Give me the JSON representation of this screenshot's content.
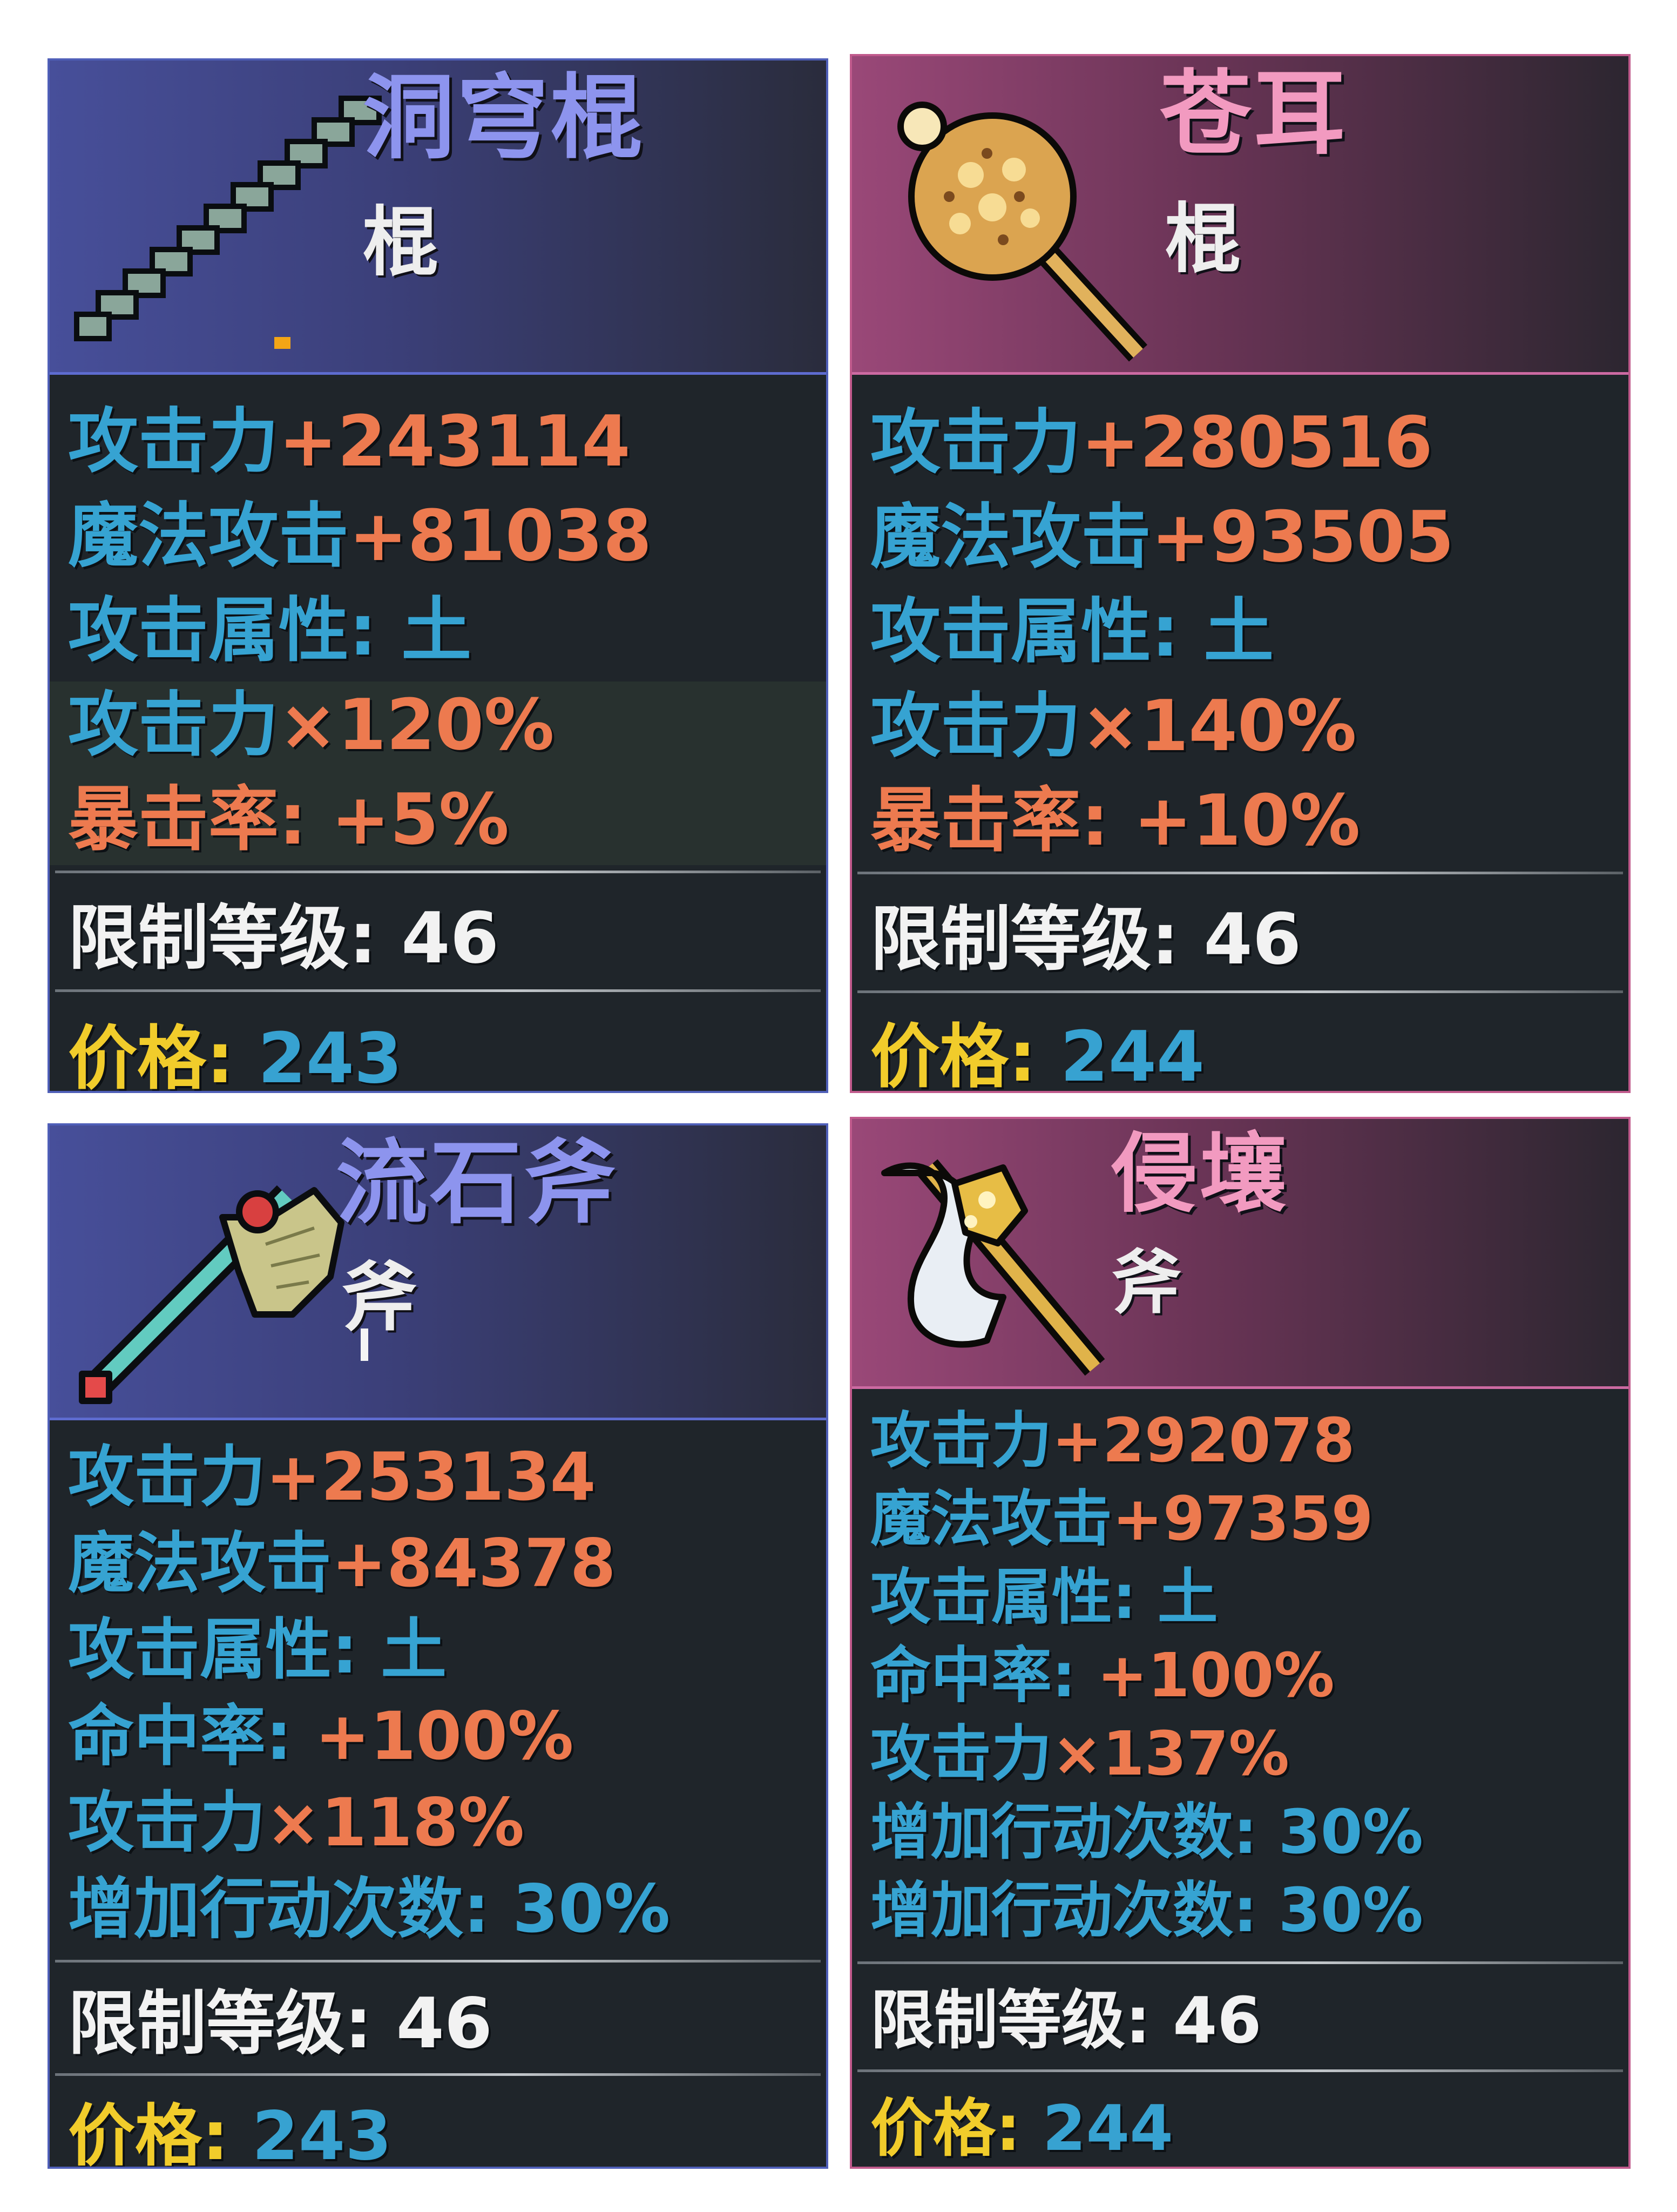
{
  "cards": [
    {
      "name": "洞穹棍",
      "type": "棍",
      "theme": "blue",
      "icon": "staff-icon",
      "stats": [
        {
          "label": "攻击力",
          "value": "+243114"
        },
        {
          "label": "魔法攻击",
          "value": "+81038"
        },
        {
          "label": "攻击属性: ",
          "value": "土"
        },
        {
          "label": "攻击力",
          "value": "×120%"
        },
        {
          "label": "暴击率: +5%",
          "value": ""
        }
      ],
      "requirement": "限制等级: 46",
      "price_label": "价格: ",
      "price_value": "243"
    },
    {
      "name": "苍耳",
      "type": "棍",
      "theme": "pink",
      "icon": "spiked-mace-icon",
      "stats": [
        {
          "label": "攻击力",
          "value": "+280516"
        },
        {
          "label": "魔法攻击",
          "value": "+93505"
        },
        {
          "label": "攻击属性: ",
          "value": "土"
        },
        {
          "label": "攻击力",
          "value": "×140%"
        },
        {
          "label": "暴击率: +10%",
          "value": ""
        }
      ],
      "requirement": "限制等级: 46",
      "price_label": "价格: ",
      "price_value": "244"
    },
    {
      "name": "流石斧",
      "type": "斧",
      "theme": "blue",
      "icon": "axe-icon",
      "stats": [
        {
          "label": "攻击力",
          "value": "+253134"
        },
        {
          "label": "魔法攻击",
          "value": "+84378"
        },
        {
          "label": "攻击属性: ",
          "value": "土"
        },
        {
          "label": "命中率: ",
          "value": "+100%"
        },
        {
          "label": "攻击力",
          "value": "×118%"
        },
        {
          "label": "增加行动次数: 30%",
          "value": ""
        }
      ],
      "requirement": "限制等级: 46",
      "price_label": "价格: ",
      "price_value": "243"
    },
    {
      "name": "侵壤",
      "type": "斧",
      "theme": "pink",
      "icon": "golden-axe-icon",
      "stats": [
        {
          "label": "攻击力",
          "value": "+292078"
        },
        {
          "label": "魔法攻击",
          "value": "+97359"
        },
        {
          "label": "攻击属性: ",
          "value": "土"
        },
        {
          "label": "命中率: ",
          "value": "+100%"
        },
        {
          "label": "攻击力",
          "value": "×137%"
        },
        {
          "label": "增加行动次数: 30%",
          "value": ""
        },
        {
          "label": "增加行动次数: 30%",
          "value": ""
        }
      ],
      "requirement": "限制等级: 46",
      "price_label": "价格: ",
      "price_value": "244"
    }
  ]
}
